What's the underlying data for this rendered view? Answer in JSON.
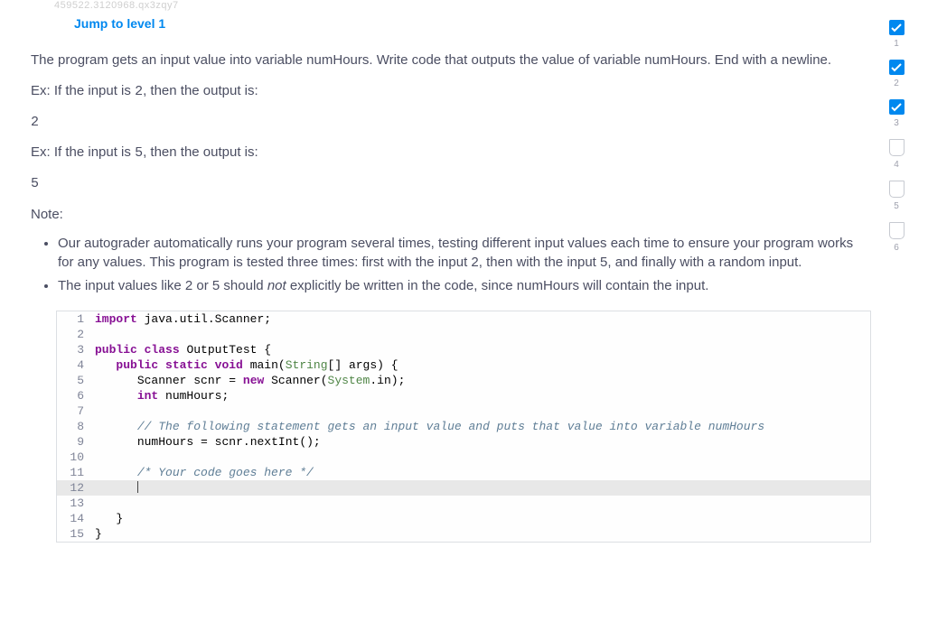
{
  "hash": "459522.3120968.qx3zqy7",
  "jump_link": "Jump to level 1",
  "intro": "The program gets an input value into variable numHours. Write code that outputs the value of variable numHours. End with a newline.",
  "ex1_prefix": "Ex: If the input is ",
  "ex1_val": "2",
  "ex1_suffix": ", then the output is:",
  "ex1_out": "2",
  "ex2_prefix": "Ex: If the input is ",
  "ex2_val": "5",
  "ex2_suffix": ", then the output is:",
  "ex2_out": "5",
  "note_label": "Note:",
  "note1": "Our autograder automatically runs your program several times, testing different input values each time to ensure your program works for any values. This program is tested three times: first with the input 2, then with the input 5, and finally with a random input.",
  "note2_a": "The input values like 2 or 5 should ",
  "note2_not": "not",
  "note2_b": " explicitly be written in the code, since numHours will contain the input.",
  "code": {
    "l1": {
      "n": "1"
    },
    "l2": {
      "n": "2"
    },
    "l3": {
      "n": "3"
    },
    "l4": {
      "n": "4"
    },
    "l5": {
      "n": "5"
    },
    "l6": {
      "n": "6"
    },
    "l7": {
      "n": "7"
    },
    "l8": {
      "n": "8"
    },
    "l9": {
      "n": "9"
    },
    "l10": {
      "n": "10"
    },
    "l11": {
      "n": "11"
    },
    "l12": {
      "n": "12"
    },
    "l13": {
      "n": "13"
    },
    "l14": {
      "n": "14"
    },
    "l15": {
      "n": "15"
    },
    "kw_import": "import",
    "sp": " ",
    "java_util_scanner": "java.util.Scanner",
    ";": ";",
    "kw_public": "public",
    "kw_class": "class",
    "OutputTest": "OutputTest",
    "brace_open": "{",
    "brace_close": "}",
    "kw_static": "static",
    "kw_void": "void",
    "main": "main",
    "lparen": "(",
    "rparen": ")",
    "String": "String",
    "arr": "[]",
    "args": "args",
    "Scanner": "Scanner",
    "scnr": "scnr",
    "eq": "=",
    "kw_new": "new",
    "System": "System",
    "dot": ".",
    "in": "in",
    "kw_int": "int",
    "numHours": "numHours",
    "comment1": "// The following statement gets an input value and puts that value into variable numHours",
    "nextInt": "nextInt",
    "empty_parens": "()",
    "comment2": "/* Your code goes here */"
  },
  "progress": {
    "1": {
      "num": "1",
      "done": true
    },
    "2": {
      "num": "2",
      "done": true
    },
    "3": {
      "num": "3",
      "done": true
    },
    "4": {
      "num": "4",
      "done": false
    },
    "5": {
      "num": "5",
      "done": false
    },
    "6": {
      "num": "6",
      "done": false
    }
  }
}
